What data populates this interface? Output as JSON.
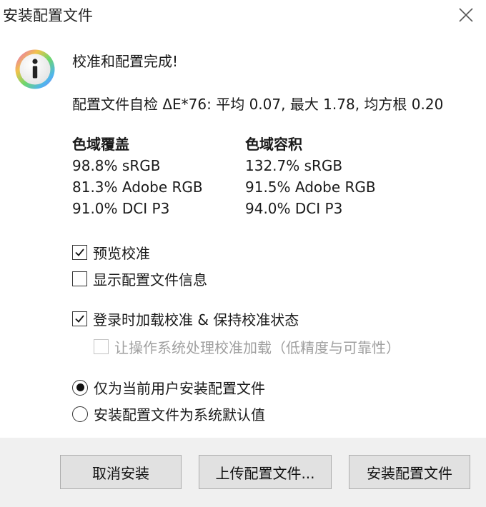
{
  "window": {
    "title": "安装配置文件",
    "close_icon": "close-icon"
  },
  "message": {
    "icon": "info-icon",
    "headline": "校准和配置完成!",
    "selfcheck": "配置文件自检 ΔE*76: 平均 0.07, 最大 1.78, 均方根 0.20"
  },
  "gamut": {
    "coverage": {
      "heading": "色域覆盖",
      "rows": [
        "98.8% sRGB",
        "81.3% Adobe RGB",
        "91.0% DCI P3"
      ]
    },
    "volume": {
      "heading": "色域容积",
      "rows": [
        "132.7% sRGB",
        "91.5% Adobe RGB",
        "94.0% DCI P3"
      ]
    }
  },
  "options": {
    "preview_calibration": {
      "label": "预览校准",
      "checked": true
    },
    "show_profile_info": {
      "label": "显示配置文件信息",
      "checked": false
    },
    "load_on_login": {
      "label": "登录时加载校准 & 保持校准状态",
      "checked": true
    },
    "os_handles_loading": {
      "label": "让操作系统处理校准加载（低精度与可靠性）",
      "checked": false,
      "disabled": true
    }
  },
  "install_scope": {
    "current_user": {
      "label": "仅为当前用户安装配置文件",
      "selected": true
    },
    "system_default": {
      "label": "安装配置文件为系统默认值",
      "selected": false
    }
  },
  "buttons": {
    "cancel": "取消安装",
    "upload": "上传配置文件...",
    "install": "安装配置文件"
  }
}
